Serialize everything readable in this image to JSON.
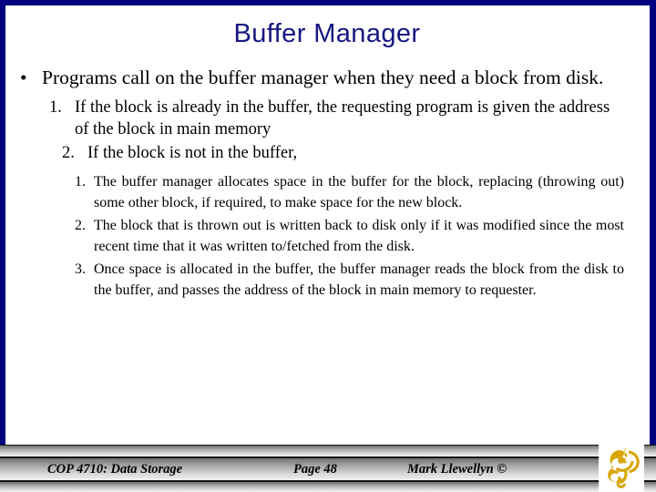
{
  "slide": {
    "title": "Buffer Manager",
    "title_color": "#161681",
    "frame_color": "#000080",
    "background": "#ffffff"
  },
  "content": {
    "bullet_glyph": "•",
    "level1": "Programs call on the buffer manager when they need a block from disk.",
    "level2": [
      {
        "number": "1.",
        "text": "If the block is already in the buffer, the requesting program is given the address of the block in main memory"
      },
      {
        "number": "2.",
        "text": "If the block is not in the buffer,"
      }
    ],
    "level3": [
      {
        "number": "1.",
        "text": "The buffer manager allocates space in the buffer for the block, replacing (throwing out) some other block, if required, to make space for the new block."
      },
      {
        "number": "2.",
        "text": "The block that is thrown out is written back to disk only if it was modified since the most recent time that it was written to/fetched from the disk."
      },
      {
        "number": "3.",
        "text": "Once space is allocated in the buffer, the buffer manager reads the block from the disk to the buffer, and passes the address of the block in main memory to requester."
      }
    ]
  },
  "footer": {
    "course": "COP 4710: Data Storage",
    "page": "Page 48",
    "author": "Mark Llewellyn ©",
    "logo_name": "ucf-pegasus-logo",
    "logo_color": "#D9A60A"
  }
}
